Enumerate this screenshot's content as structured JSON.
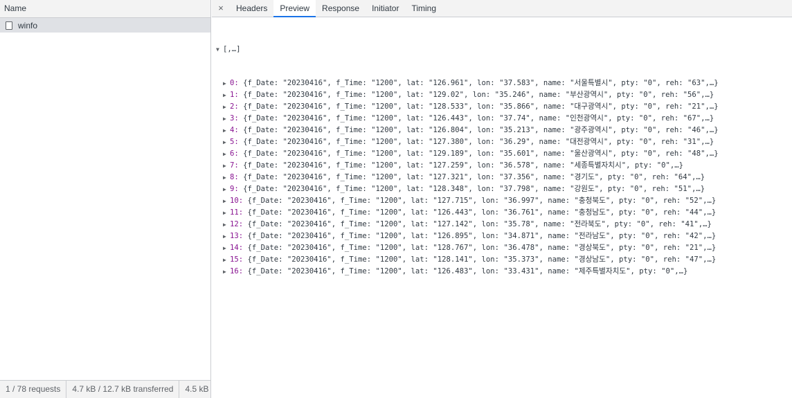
{
  "left": {
    "header": "Name",
    "requests": [
      {
        "name": "winfo"
      }
    ],
    "status": [
      "1 / 78 requests",
      "4.7 kB / 12.7 kB transferred",
      "4.5 kB"
    ]
  },
  "tabs": [
    "Headers",
    "Preview",
    "Response",
    "Initiator",
    "Timing"
  ],
  "active_tab": "Preview",
  "close_icon": "×",
  "preview": {
    "root_label": "[,…]",
    "items": [
      "{f_Date: \"20230416\", f_Time: \"1200\", lat: \"126.961\", lon: \"37.583\", name: \"서울특별시\", pty: \"0\", reh: \"63\",…}",
      "{f_Date: \"20230416\", f_Time: \"1200\", lat: \"129.02\", lon: \"35.246\", name: \"부산광역시\", pty: \"0\", reh: \"56\",…}",
      "{f_Date: \"20230416\", f_Time: \"1200\", lat: \"128.533\", lon: \"35.866\", name: \"대구광역시\", pty: \"0\", reh: \"21\",…}",
      "{f_Date: \"20230416\", f_Time: \"1200\", lat: \"126.443\", lon: \"37.74\", name: \"인천광역시\", pty: \"0\", reh: \"67\",…}",
      "{f_Date: \"20230416\", f_Time: \"1200\", lat: \"126.804\", lon: \"35.213\", name: \"광주광역시\", pty: \"0\", reh: \"46\",…}",
      "{f_Date: \"20230416\", f_Time: \"1200\", lat: \"127.380\", lon: \"36.29\", name: \"대전광역시\", pty: \"0\", reh: \"31\",…}",
      "{f_Date: \"20230416\", f_Time: \"1200\", lat: \"129.189\", lon: \"35.601\", name: \"울산광역시\", pty: \"0\", reh: \"48\",…}",
      "{f_Date: \"20230416\", f_Time: \"1200\", lat: \"127.259\", lon: \"36.578\", name: \"세종특별자치시\", pty: \"0\",…}",
      "{f_Date: \"20230416\", f_Time: \"1200\", lat: \"127.321\", lon: \"37.356\", name: \"경기도\", pty: \"0\", reh: \"64\",…}",
      "{f_Date: \"20230416\", f_Time: \"1200\", lat: \"128.348\", lon: \"37.798\", name: \"강원도\", pty: \"0\", reh: \"51\",…}",
      "{f_Date: \"20230416\", f_Time: \"1200\", lat: \"127.715\", lon: \"36.997\", name: \"충청북도\", pty: \"0\", reh: \"52\",…}",
      "{f_Date: \"20230416\", f_Time: \"1200\", lat: \"126.443\", lon: \"36.761\", name: \"충청남도\", pty: \"0\", reh: \"44\",…}",
      "{f_Date: \"20230416\", f_Time: \"1200\", lat: \"127.142\", lon: \"35.78\", name: \"전라북도\", pty: \"0\", reh: \"41\",…}",
      "{f_Date: \"20230416\", f_Time: \"1200\", lat: \"126.895\", lon: \"34.871\", name: \"전라남도\", pty: \"0\", reh: \"42\",…}",
      "{f_Date: \"20230416\", f_Time: \"1200\", lat: \"128.767\", lon: \"36.478\", name: \"경상북도\", pty: \"0\", reh: \"21\",…}",
      "{f_Date: \"20230416\", f_Time: \"1200\", lat: \"128.141\", lon: \"35.373\", name: \"경상남도\", pty: \"0\", reh: \"47\",…}",
      "{f_Date: \"20230416\", f_Time: \"1200\", lat: \"126.483\", lon: \"33.431\", name: \"제주특별자치도\", pty: \"0\",…}"
    ]
  }
}
